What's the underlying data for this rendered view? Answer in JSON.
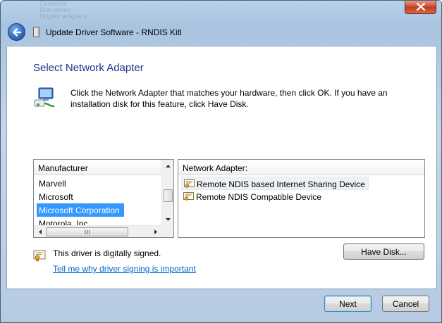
{
  "window": {
    "title": "Update Driver Software - RNDIS Kitl",
    "background_ghost": [
      "Computer",
      "Disk drives",
      "Display adapters"
    ]
  },
  "content": {
    "heading": "Select Network Adapter",
    "intro": "Click the Network Adapter that matches your hardware, then click OK. If you have an installation disk for this feature, click Have Disk."
  },
  "manufacturer_list": {
    "header": "Manufacturer",
    "items": [
      "Marvell",
      "Microsoft",
      "Microsoft Corporation",
      "Motorola, Inc."
    ],
    "selected": "Microsoft Corporation"
  },
  "adapter_list": {
    "header": "Network Adapter:",
    "items": [
      "Remote NDIS based Internet Sharing Device",
      "Remote NDIS Compatible Device"
    ]
  },
  "signature": {
    "status": "This driver is digitally signed.",
    "link": "Tell me why driver signing is important"
  },
  "buttons": {
    "have_disk": "Have Disk...",
    "next": "Next",
    "cancel": "Cancel"
  },
  "colors": {
    "heading": "#1e3287",
    "selection": "#3399ff",
    "link": "#0066cc",
    "close_button": "#c23b1e"
  },
  "icons": {
    "back": "back-arrow-icon",
    "close": "close-icon",
    "network": "network-adapter-icon",
    "certificate": "certificate-icon"
  }
}
